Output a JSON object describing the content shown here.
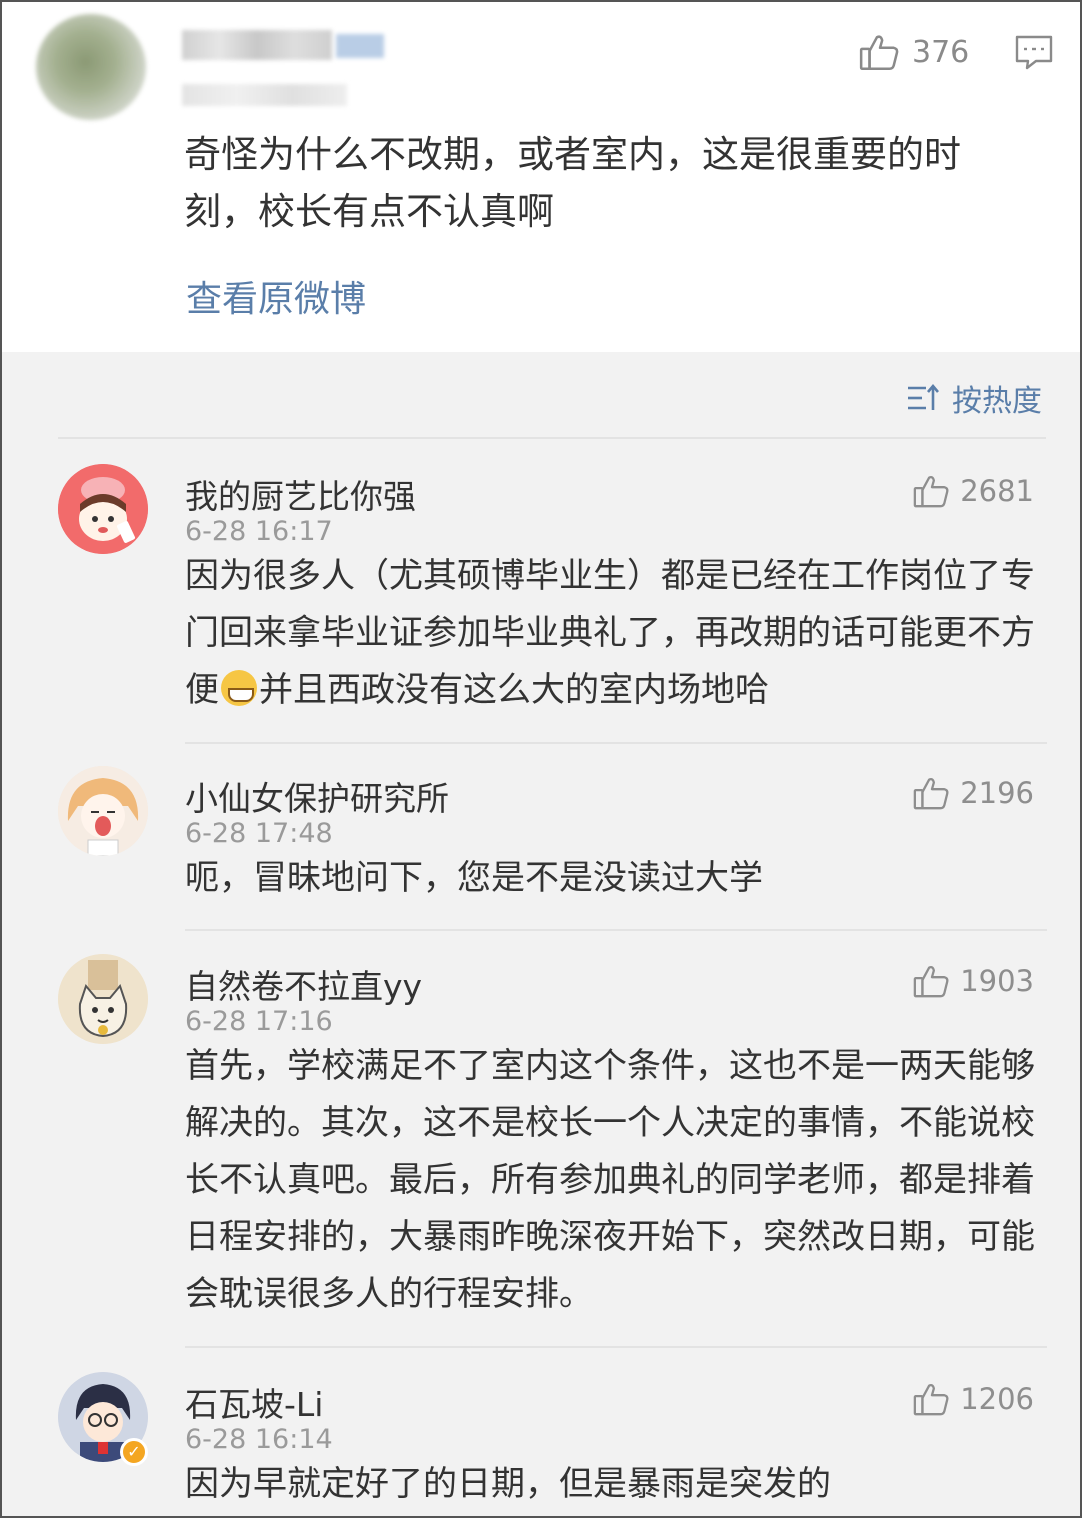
{
  "post": {
    "like_count": "376",
    "text": "奇怪为什么不改期，或者室内，这是很重要的时刻，校长有点不认真啊",
    "view_original_label": "查看原微博"
  },
  "sort": {
    "label": "按热度"
  },
  "comments": [
    {
      "username": "我的厨艺比你强",
      "time": "6-28 16:17",
      "likes": "2681",
      "text_before_emoji": "因为很多人（尤其硕博毕业生）都是已经在工作岗位了专门回来拿毕业证参加毕业典礼了，再改期的话可能更不方便",
      "text_after_emoji": "并且西政没有这么大的室内场地哈"
    },
    {
      "username": "小仙女保护研究所",
      "time": "6-28 17:48",
      "likes": "2196",
      "text": "呃，冒昧地问下，您是不是没读过大学"
    },
    {
      "username": "自然卷不拉直yy",
      "time": "6-28 17:16",
      "likes": "1903",
      "text": "首先，学校满足不了室内这个条件，这也不是一两天能够解决的。其次，这不是校长一个人决定的事情，不能说校长不认真吧。最后，所有参加典礼的同学老师，都是排着日程安排的，大暴雨昨晚深夜开始下，突然改日期，可能会耽误很多人的行程安排。"
    },
    {
      "username": "石瓦坡-Li",
      "time": "6-28 16:14",
      "likes": "1206",
      "text": "因为早就定好了的日期，但是暴雨是突发的"
    }
  ],
  "colors": {
    "link": "#5a7ea9",
    "text": "#333333",
    "meta": "#9a9a9a",
    "background": "#f2f2f2",
    "card": "#ffffff",
    "verified_badge": "#f4a622"
  },
  "icons": [
    "thumbs-up-icon",
    "comment-icon",
    "sort-icon",
    "smile-emoji-icon",
    "verified-icon"
  ]
}
